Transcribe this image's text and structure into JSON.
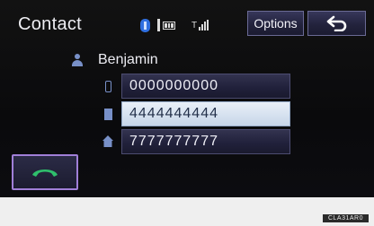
{
  "header": {
    "title": "Contact",
    "options_label": "Options",
    "back_icon": "back-arrow-icon",
    "status_icons": [
      "bluetooth-icon",
      "phone-battery-icon",
      "signal-strength-icon"
    ],
    "signal_prefix": "T"
  },
  "contact": {
    "name": "Benjamin",
    "numbers": [
      {
        "type_icon": "mobile-phone-icon",
        "value": "0000000000",
        "selected": false
      },
      {
        "type_icon": "work-phone-icon",
        "value": "4444444444",
        "selected": true
      },
      {
        "type_icon": "home-phone-icon",
        "value": "7777777777",
        "selected": false
      }
    ]
  },
  "call_button_icon": "call-handset-icon",
  "footer": {
    "code": "CLA31AR0"
  },
  "colors": {
    "screen_bg": "#0c0c10",
    "accent_selection": "#c7d6e8",
    "call_icon": "#2fbf6c",
    "icon_blue": "#7890c8",
    "call_border": "#a07fd8"
  }
}
